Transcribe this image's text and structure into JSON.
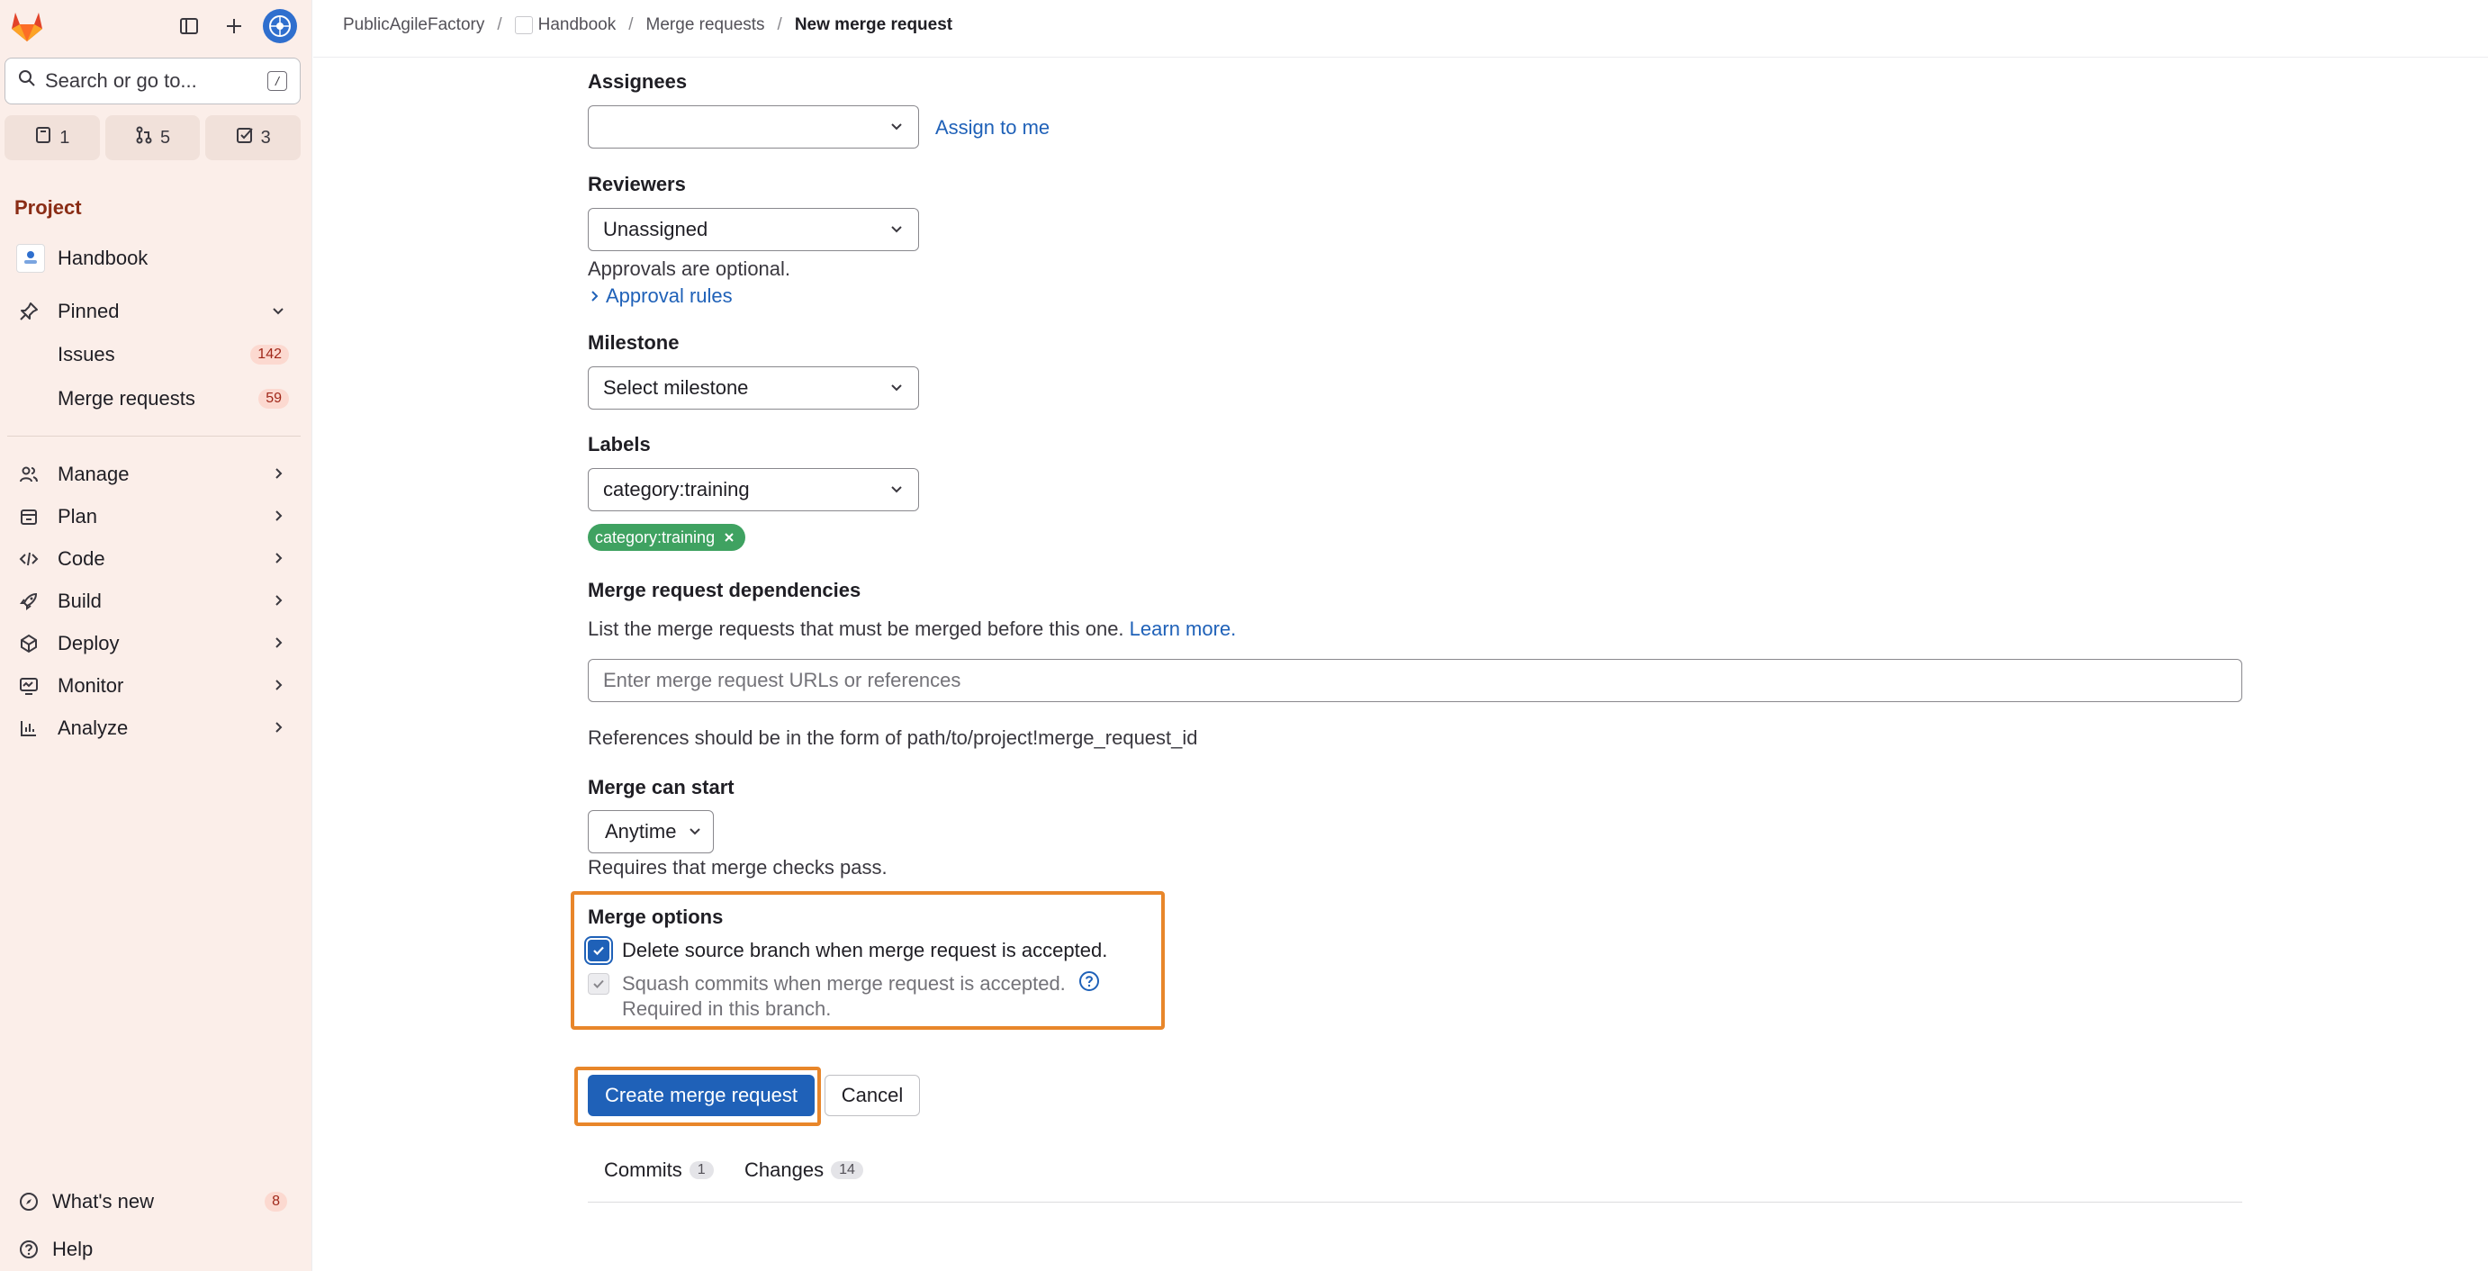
{
  "sidebar": {
    "search_placeholder": "Search or go to...",
    "search_kbd": "/",
    "counts": [
      {
        "icon": "issues-icon",
        "value": "1"
      },
      {
        "icon": "merge-request-icon",
        "value": "5"
      },
      {
        "icon": "todo-icon",
        "value": "3"
      }
    ],
    "section_heading": "Project",
    "project_name": "Handbook",
    "pinned_label": "Pinned",
    "pinned_items": [
      {
        "label": "Issues",
        "badge": "142"
      },
      {
        "label": "Merge requests",
        "badge": "59"
      }
    ],
    "nav_items": [
      {
        "label": "Manage",
        "icon": "users-icon"
      },
      {
        "label": "Plan",
        "icon": "calendar-icon"
      },
      {
        "label": "Code",
        "icon": "code-icon"
      },
      {
        "label": "Build",
        "icon": "rocket-icon"
      },
      {
        "label": "Deploy",
        "icon": "deploy-icon"
      },
      {
        "label": "Monitor",
        "icon": "monitor-icon"
      },
      {
        "label": "Analyze",
        "icon": "chart-icon"
      }
    ],
    "whats_new": {
      "label": "What's new",
      "badge": "8"
    },
    "help_label": "Help"
  },
  "breadcrumb": {
    "items": [
      "PublicAgileFactory",
      "Handbook",
      "Merge requests"
    ],
    "current": "New merge request"
  },
  "form": {
    "assignees": {
      "label": "Assignees",
      "value": "",
      "assign_me": "Assign to me"
    },
    "reviewers": {
      "label": "Reviewers",
      "value": "Unassigned",
      "help": "Approvals are optional.",
      "rules_link": "Approval rules"
    },
    "milestone": {
      "label": "Milestone",
      "value": "Select milestone"
    },
    "labels": {
      "label": "Labels",
      "value": "category:training",
      "pill": "category:training",
      "pill_color": "#3fa261"
    },
    "dependencies": {
      "label": "Merge request dependencies",
      "help": "List the merge requests that must be merged before this one.",
      "learn_more": "Learn more.",
      "placeholder": "Enter merge request URLs or references",
      "format_help": "References should be in the form of path/to/project!merge_request_id"
    },
    "merge_start": {
      "label": "Merge can start",
      "value": "Anytime",
      "help": "Requires that merge checks pass."
    },
    "merge_options": {
      "label": "Merge options",
      "delete_branch": {
        "label": "Delete source branch when merge request is accepted.",
        "checked": true
      },
      "squash": {
        "label": "Squash commits when merge request is accepted.",
        "checked": true,
        "disabled": true,
        "note": "Required in this branch."
      }
    },
    "actions": {
      "create": "Create merge request",
      "cancel": "Cancel"
    },
    "tabs": [
      {
        "label": "Commits",
        "count": "1"
      },
      {
        "label": "Changes",
        "count": "14"
      }
    ]
  },
  "colors": {
    "accent": "#1f61b8",
    "highlight": "#e8862a",
    "sidebar_bg": "#fbeee9"
  }
}
